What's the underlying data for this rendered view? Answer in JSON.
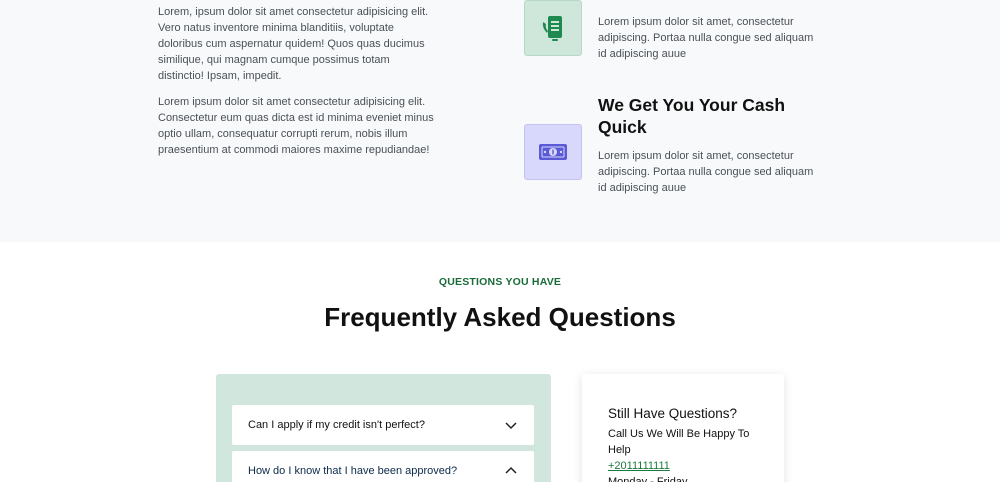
{
  "about": {
    "paragraph1": "Lorem, ipsum dolor sit amet consectetur adipisicing elit. Vero natus inventore minima blanditiis, voluptate doloribus cum aspernatur quidem! Quos quas ducimus similique, qui magnam cumque possimus totam distinctio! Ipsam, impedit.",
    "paragraph2": "Lorem ipsum dolor sit amet consectetur adipisicing elit. Consectetur eum quas dicta est id minima eveniet minus optio ullam, consequatur corrupti rerum, nobis illum praesentium at commodi maiores maxime repudiandae!"
  },
  "features": [
    {
      "icon": "phone-payment-icon",
      "title": "",
      "text": "Lorem ipsum dolor sit amet, consectetur adipiscing. Portaa nulla congue sed aliquam id adipiscing auue"
    },
    {
      "icon": "cash-bill-icon",
      "title": "We Get You Your Cash Quick",
      "text": "Lorem ipsum dolor sit amet, consectetur adipiscing. Portaa nulla congue sed aliquam id adipiscing auue"
    }
  ],
  "faq": {
    "eyebrow": "QUESTIONS YOU HAVE",
    "title": "Frequently Asked Questions",
    "items": [
      {
        "question": "Can I apply if my credit isn't perfect?",
        "state": "collapsed"
      },
      {
        "question": "How do I know that I have been approved?",
        "state": "expanded"
      }
    ]
  },
  "contact": {
    "title": "Still Have Questions?",
    "subtitle": "Call Us We Will Be Happy To Help",
    "phone": "+2011111111",
    "hours": "Monday - Friday"
  },
  "colors": {
    "accent_green": "#1a6b3a",
    "faq_panel_bg": "#d1e7dd",
    "icon_green_bg": "#cfe6da",
    "icon_purple_bg": "#d8d8fc"
  }
}
